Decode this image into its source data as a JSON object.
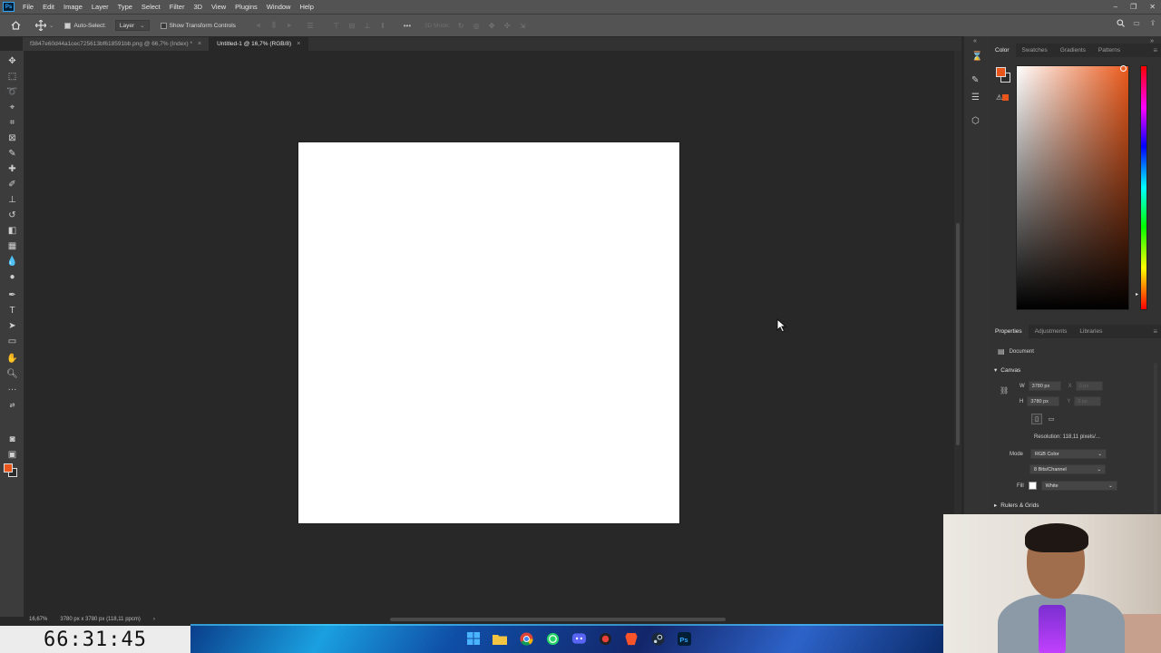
{
  "menubar": {
    "app_icon": "Ps",
    "items": [
      "File",
      "Edit",
      "Image",
      "Layer",
      "Type",
      "Select",
      "Filter",
      "3D",
      "View",
      "Plugins",
      "Window",
      "Help"
    ]
  },
  "options": {
    "auto_select_label": "Auto-Select:",
    "auto_select_checked": true,
    "target_value": "Layer",
    "show_transform_label": "Show Transform Controls",
    "threed_mode_label": "3D Mode:"
  },
  "tabs": [
    {
      "label": "f3847e60d44a1cec725613bf618591bb.png @ 66,7% (Index) *",
      "active": false
    },
    {
      "label": "Untitled-1 @ 16,7% (RGB/8)",
      "active": true
    }
  ],
  "status": {
    "zoom": "16,67%",
    "doc_info": "3780 px x 3780 px (118,11 ppcm)"
  },
  "color_panel": {
    "tabs": [
      "Color",
      "Swatches",
      "Gradients",
      "Patterns"
    ],
    "foreground": "#e9561b",
    "background": "#2b2b2b"
  },
  "properties_panel": {
    "tabs": [
      "Properties",
      "Adjustments",
      "Libraries"
    ],
    "doc_label": "Document",
    "canvas_section": "Canvas",
    "w_label": "W",
    "w_value": "3780 px",
    "h_label": "H",
    "h_value": "3780 px",
    "x_label": "X",
    "y_label": "Y",
    "x_placeholder": "0 px",
    "y_placeholder": "0 px",
    "resolution": "Resolution: 118,11 pixels/...",
    "mode_label": "Mode",
    "mode_value": "RGB Color",
    "bits_value": "8 Bits/Channel",
    "fill_label": "Fill",
    "fill_value": "White",
    "rulers_section": "Rulers & Grids"
  },
  "timer": "66:31:45",
  "taskbar_icons": [
    "windows-icon",
    "file-explorer-icon",
    "chrome-icon",
    "whatsapp-icon",
    "discord-icon",
    "app-icon",
    "brave-icon",
    "steam-icon",
    "photoshop-icon"
  ]
}
